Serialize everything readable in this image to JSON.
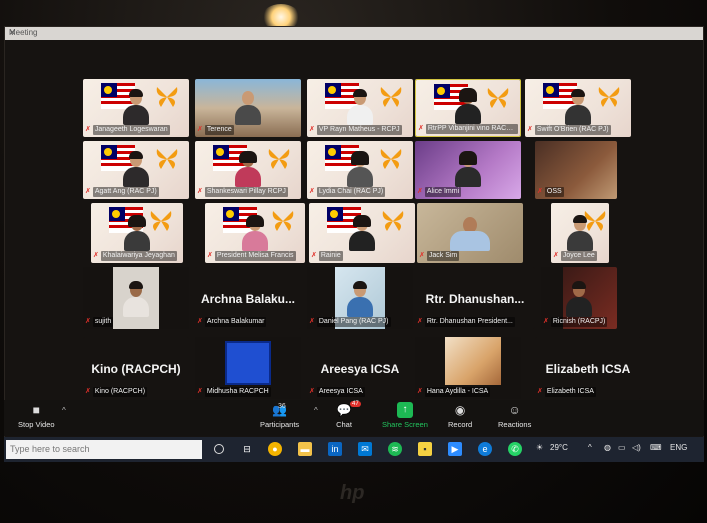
{
  "window": {
    "title": "Meeting"
  },
  "tiles": [
    {
      "name": "Janageeth Logeswaran",
      "big": ""
    },
    {
      "name": "Terence",
      "big": ""
    },
    {
      "name": "VP Rayn Matheus - RCPJ",
      "big": ""
    },
    {
      "name": "RtrPP Vibanjini vino RACPCH",
      "big": ""
    },
    {
      "name": "Swift O'Brien (RAC PJ)",
      "big": ""
    },
    {
      "name": "Agatt Ang (RAC PJ)",
      "big": ""
    },
    {
      "name": "Shankeswari Pillay RCPJ",
      "big": ""
    },
    {
      "name": "Lydia Chai (RAC PJ)",
      "big": ""
    },
    {
      "name": "Alice Immi",
      "big": ""
    },
    {
      "name": "OSS",
      "big": ""
    },
    {
      "name": "Khalaiwariya Jeyaghan",
      "big": ""
    },
    {
      "name": "President Melisa Francis",
      "big": ""
    },
    {
      "name": "Rainie",
      "big": ""
    },
    {
      "name": "Jack Sim",
      "big": ""
    },
    {
      "name": "Joyce Lee",
      "big": ""
    },
    {
      "name": "sujith",
      "big": ""
    },
    {
      "name": "Archna Balakumar",
      "big": "Archna Balaku..."
    },
    {
      "name": "Daniel Pang (RAC PJ)",
      "big": ""
    },
    {
      "name": "Rtr. Dhanushan President...",
      "big": "Rtr. Dhanushan..."
    },
    {
      "name": "Ricnish (RACPJ)",
      "big": ""
    },
    {
      "name": "Kino (RACPCH)",
      "big": "Kino (RACPCH)"
    },
    {
      "name": "Midhusha RACPCH",
      "big": ""
    },
    {
      "name": "Areesya ICSA",
      "big": "Areesya ICSA"
    },
    {
      "name": "Hana Aydilla - ICSA",
      "big": ""
    },
    {
      "name": "Elizabeth ICSA",
      "big": "Elizabeth ICSA"
    }
  ],
  "toolbar": {
    "stop_video": "Stop Video",
    "participants": "Participants",
    "participants_count": "36",
    "chat": "Chat",
    "chat_badge": "47",
    "share": "Share Screen",
    "record": "Record",
    "reactions": "Reactions"
  },
  "taskbar": {
    "search_placeholder": "Type here to search",
    "temperature": "29°C",
    "language": "ENG"
  },
  "colors": {
    "share_green": "#22c55e",
    "mic_muted_red": "#e0302a",
    "taskbar": "#1e2430"
  },
  "icons": [
    "video-camera-icon",
    "participants-icon",
    "chat-icon",
    "share-screen-icon",
    "record-icon",
    "reactions-icon",
    "mic-muted-icon",
    "windows-search-icon",
    "weather-icon"
  ]
}
